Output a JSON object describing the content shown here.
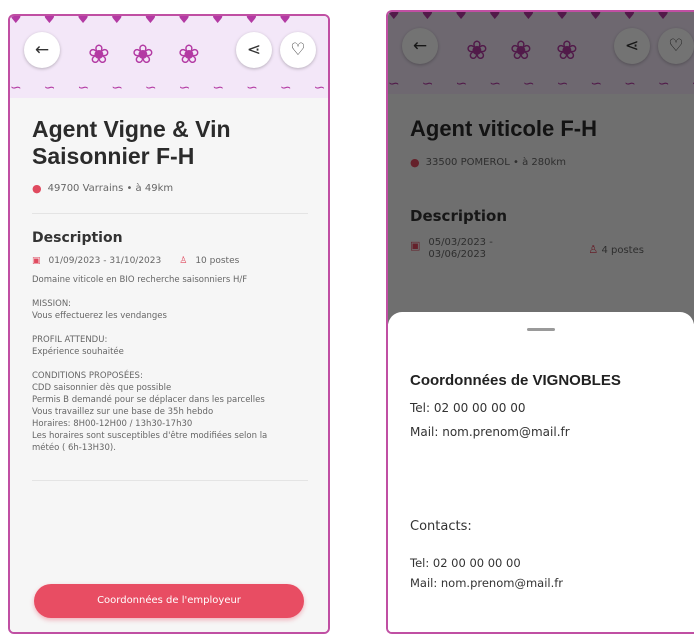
{
  "left": {
    "title_line1": "Agent Vigne & Vin",
    "title_line2": "Saisonnier F-H",
    "location": "49700 Varrains • à 49km",
    "description_heading": "Description",
    "dates": "01/09/2023 - 31/10/2023",
    "posts": "10 postes",
    "intro": "Domaine viticole en BIO recherche saisonniers H/F",
    "mission_heading": "MISSION:",
    "mission_text": "Vous effectuerez les vendanges",
    "profile_heading": "PROFIL ATTENDU:",
    "profile_text": "Expérience souhaitée",
    "conditions_heading": "CONDITIONS PROPOSÉES:",
    "conditions_lines": [
      "CDD saisonnier dès que possible",
      "Permis B demandé pour se déplacer dans les parcelles",
      "Vous travaillez sur une base de 35h hebdo",
      "Horaires: 8H00-12H00 / 13h30-17h30",
      "Les horaires sont susceptibles d'être modifiées selon la",
      "météo ( 6h-13H30)."
    ],
    "cta_label": "Coordonnées de l'employeur"
  },
  "right": {
    "title": "Agent viticole F-H",
    "location": "33500 POMEROL • à 280km",
    "description_heading": "Description",
    "dates_line1": "05/03/2023 -",
    "dates_line2": "03/06/2023",
    "posts": "4 postes",
    "sheet_title": "Coordonnées de VIGNOBLES",
    "tel": "Tel: 02 00 00 00 00",
    "mail": "Mail: nom.prenom@mail.fr",
    "contacts_heading": "Contacts:",
    "contact_tel": "Tel: 02 00 00 00 00",
    "contact_mail": "Mail: nom.prenom@mail.fr"
  },
  "icons": {
    "back": "←",
    "share": "⋖",
    "heart": "♡",
    "pin": "●",
    "calendar": "▣",
    "person": "♙",
    "grape": "❀"
  },
  "colors": {
    "accent": "#e84d63",
    "brand_purple": "#b33aa3",
    "banner_bg": "#f3e7f8"
  }
}
